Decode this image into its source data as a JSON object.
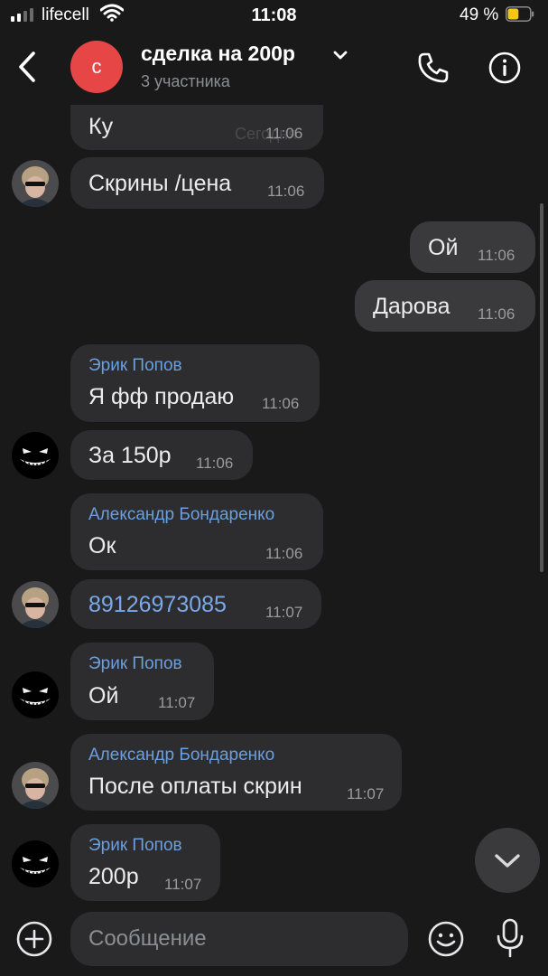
{
  "status_bar": {
    "carrier": "lifecell",
    "time": "11:08",
    "battery_percent": "49 %",
    "signal_bars": 2,
    "battery_level": 0.49
  },
  "header": {
    "avatar_letter": "с",
    "title": "сделка на 200р",
    "subtitle": "3 участника"
  },
  "date_chip": "Сегодня",
  "messages": [
    {
      "text": "Ку",
      "time": "11:06"
    },
    {
      "text": "Скрины /цена",
      "time": "11:06"
    },
    {
      "text": "Ой",
      "time": "11:06"
    },
    {
      "text": "Дарова",
      "time": "11:06"
    },
    {
      "sender": "Эрик Попов",
      "text": "Я фф продаю",
      "time": "11:06"
    },
    {
      "text": "За 150р",
      "time": "11:06"
    },
    {
      "sender": "Александр Бондаренко",
      "text": "Ок",
      "time": "11:06"
    },
    {
      "text": "89126973085",
      "time": "11:07"
    },
    {
      "sender": "Эрик Попов",
      "text": "Ой",
      "time": "11:07"
    },
    {
      "sender": "Александр Бондаренко",
      "text": "После оплаты скрин",
      "time": "11:07"
    },
    {
      "sender": "Эрик Попов",
      "text": "200р",
      "time": "11:07"
    }
  ],
  "input": {
    "placeholder": "Сообщение"
  },
  "icons": {
    "back": "back-chevron-icon",
    "dropdown": "chevron-down-icon",
    "call": "phone-icon",
    "info": "info-icon",
    "attach": "plus-circle-icon",
    "emoji": "emoji-icon",
    "voice": "microphone-icon",
    "scroll_down": "chevron-down-icon"
  },
  "colors": {
    "background": "#19191a",
    "bubble_incoming": "#2d2d2f",
    "bubble_outgoing": "#3a3a3c",
    "sender_name": "#6a9fe0",
    "chat_avatar": "#e64646",
    "battery": "#f5c518"
  }
}
